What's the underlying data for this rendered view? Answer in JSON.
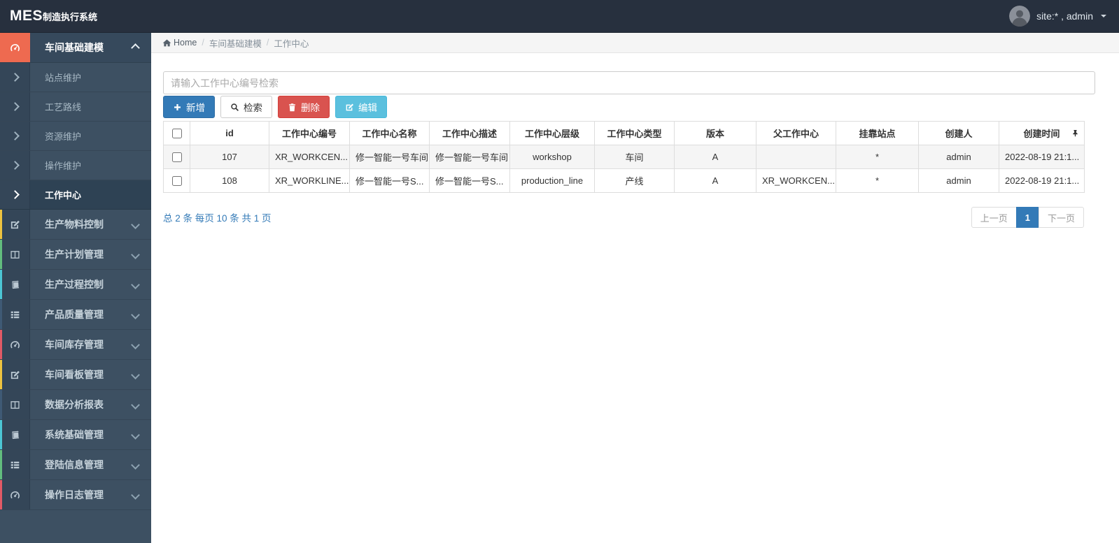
{
  "navbar": {
    "brand_bold": "MES",
    "brand_rest": "制造执行系统",
    "user_label": "site:* , admin",
    "avatar_icon": "avatar",
    "caret_icon": "caret-down-icon"
  },
  "breadcrumb": {
    "home_icon": "home-icon",
    "home": "Home",
    "separator": "/",
    "items": [
      "车间基础建模",
      "工作中心"
    ]
  },
  "sidebar": {
    "groups": [
      {
        "label": "车间基础建模",
        "icon": "gauge-icon",
        "state": "expanded",
        "accent": "#ee6a50",
        "children": [
          {
            "label": "站点维护",
            "active": false
          },
          {
            "label": "工艺路线",
            "active": false
          },
          {
            "label": "资源维护",
            "active": false
          },
          {
            "label": "操作维护",
            "active": false
          },
          {
            "label": "工作中心",
            "active": true
          }
        ]
      },
      {
        "label": "生产物料控制",
        "icon": "edit-icon",
        "accent": "#eec33f"
      },
      {
        "label": "生产计划管理",
        "icon": "columns-icon",
        "accent": "#62bd7e"
      },
      {
        "label": "生产过程控制",
        "icon": "book-icon",
        "accent": "#4cc6d4"
      },
      {
        "label": "产品质量管理",
        "icon": "list-icon",
        "accent": "#3f5a75"
      },
      {
        "label": "车间库存管理",
        "icon": "gauge-icon",
        "accent": "#e25a66"
      },
      {
        "label": "车间看板管理",
        "icon": "edit-icon",
        "accent": "#eec33f"
      },
      {
        "label": "数据分析报表",
        "icon": "columns-icon",
        "accent": "#3f5a75"
      },
      {
        "label": "系统基础管理",
        "icon": "book-icon",
        "accent": "#4cc6d4"
      },
      {
        "label": "登陆信息管理",
        "icon": "list-icon",
        "accent": "#62bd7e"
      },
      {
        "label": "操作日志管理",
        "icon": "gauge-icon",
        "accent": "#e25a66"
      }
    ]
  },
  "toolbar": {
    "search_placeholder": "请输入工作中心编号检索",
    "buttons": [
      {
        "label": "新增",
        "icon": "plus-icon",
        "style": "primary"
      },
      {
        "label": "检索",
        "icon": "search-icon",
        "style": "default"
      },
      {
        "label": "删除",
        "icon": "trash-icon",
        "style": "danger"
      },
      {
        "label": "编辑",
        "icon": "edit-icon",
        "style": "info"
      }
    ]
  },
  "table": {
    "pin_icon": "pin-icon",
    "columns": [
      "id",
      "工作中心编号",
      "工作中心名称",
      "工作中心描述",
      "工作中心层级",
      "工作中心类型",
      "版本",
      "父工作中心",
      "挂靠站点",
      "创建人",
      "创建时间"
    ],
    "rows": [
      {
        "cells": [
          "107",
          "XR_WORKCEN...",
          "修一智能一号车间",
          "修一智能一号车间",
          "workshop",
          "车间",
          "A",
          "",
          "*",
          "admin",
          "2022-08-19 21:1..."
        ]
      },
      {
        "cells": [
          "108",
          "XR_WORKLINE...",
          "修一智能一号S...",
          "修一智能一号S...",
          "production_line",
          "产线",
          "A",
          "XR_WORKCEN...",
          "*",
          "admin",
          "2022-08-19 21:1..."
        ]
      }
    ]
  },
  "pagination": {
    "summary": "总 2 条 每页 10 条 共 1 页",
    "prev_label": "上一页",
    "current_page": "1",
    "next_label": "下一页"
  },
  "colors": {
    "navbar_bg": "#27303e",
    "sidebar_bg": "#3d5062",
    "sidebar_icon_column": "#344658",
    "sidebar_active_bg": "#2e4254",
    "brand_accent_red": "#ee6a50",
    "accent_yellow": "#eec33f",
    "accent_green": "#62bd7e",
    "accent_cyan": "#4cc6d4",
    "accent_blue": "#3f5a75",
    "accent_red": "#e25a66",
    "primary_blue": "#337ab7",
    "danger_red": "#d9534f",
    "info_cyan": "#5bc0de",
    "link_blue": "#337ab7",
    "stripe_row": "#f5f5f5"
  }
}
